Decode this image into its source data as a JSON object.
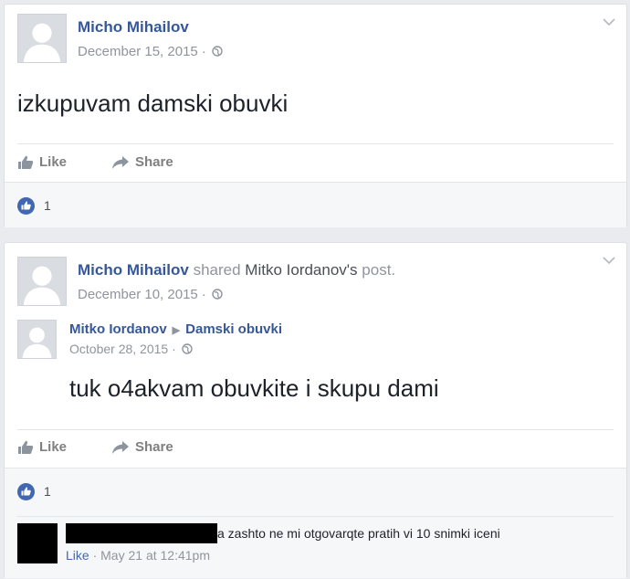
{
  "posts": [
    {
      "author": "Micho Mihailov",
      "date": "December 15, 2015",
      "separator": "·",
      "text": "izkupuvam damski obuvki",
      "like_label": "Like",
      "share_label": "Share",
      "reaction_count": "1"
    },
    {
      "author": "Micho Mihailov",
      "shared_prefix": "shared",
      "shared_author": "Mitko Iordanov's",
      "shared_suffix": "post.",
      "date": "December 10, 2015",
      "separator": "·",
      "shared_post": {
        "author": "Mitko Iordanov",
        "group": "Damski obuvki",
        "date": "October 28, 2015",
        "separator": "·",
        "text": "tuk o4akvam obuvkite i skupu dami"
      },
      "like_label": "Like",
      "share_label": "Share",
      "reaction_count": "1",
      "comment": {
        "text": "a zashto ne mi otgovarqte pratih vi 10 snimki iceni",
        "like_label": "Like",
        "separator": "·",
        "time": "May 21 at 12:41pm"
      }
    }
  ],
  "colors": {
    "link": "#365899",
    "meta": "#90949c",
    "like_blue": "#4267b2",
    "background": "#e9ebee"
  },
  "icons": {
    "like": "thumbs-up-icon",
    "share": "share-arrow-icon",
    "audience": "globe-icon",
    "menu": "chevron-down-icon"
  }
}
